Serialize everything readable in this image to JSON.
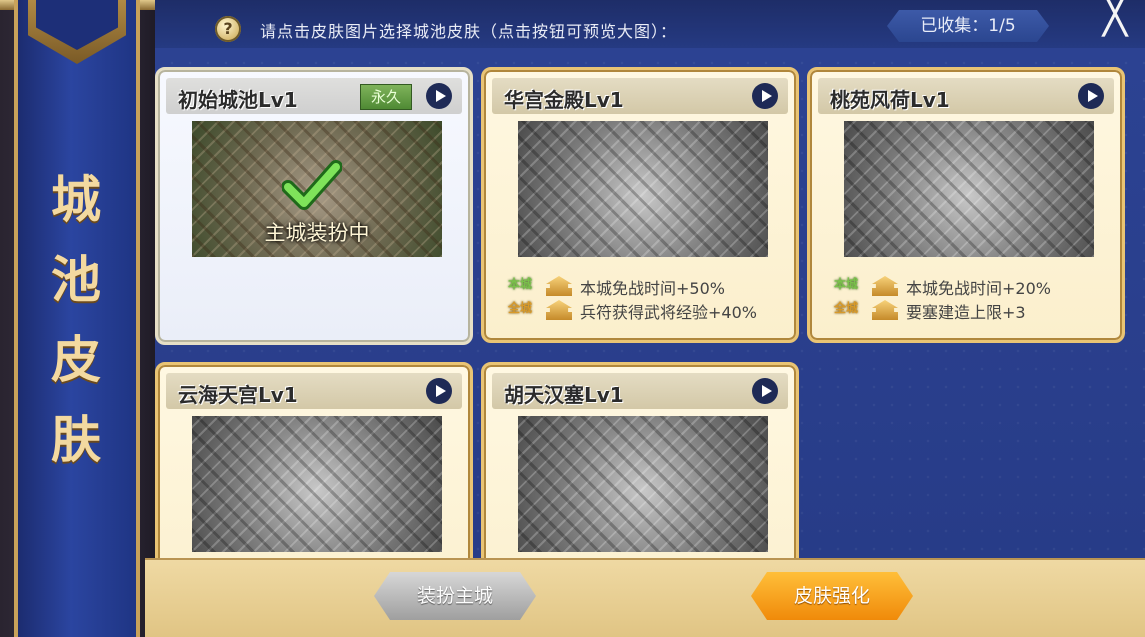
{
  "header": {
    "hint_icon_glyph": "?",
    "hint_text": "请点击皮肤图片选择城池皮肤（点击按钮可预览大图）：",
    "collected_label": "已收集：1/5",
    "close_glyph": "╳"
  },
  "banner": {
    "title_chars": [
      "城",
      "池",
      "皮",
      "肤"
    ]
  },
  "cards": [
    {
      "title": "初始城池Lv1",
      "badge": "永久",
      "selected": true,
      "thumbnail_state": "color",
      "status_label": "主城装扮中"
    },
    {
      "title": "华宫金殿Lv1",
      "selected": false,
      "thumbnail_state": "grayscale",
      "bonuses": [
        {
          "tag": "本城",
          "text": "本城免战时间+50%"
        },
        {
          "tag": "全城",
          "text": "兵符获得武将经验+40%"
        }
      ]
    },
    {
      "title": "桃苑风荷Lv1",
      "selected": false,
      "thumbnail_state": "grayscale",
      "bonuses": [
        {
          "tag": "本城",
          "text": "本城免战时间+20%"
        },
        {
          "tag": "全城",
          "text": "要塞建造上限+3"
        }
      ]
    },
    {
      "title": "云海天宫Lv1",
      "selected": false,
      "thumbnail_state": "grayscale"
    },
    {
      "title": "胡天汉塞Lv1",
      "selected": false,
      "thumbnail_state": "grayscale"
    }
  ],
  "buttons": {
    "equip": "装扮主城",
    "enhance": "皮肤强化"
  },
  "colors": {
    "panel_blue": "#2c4393",
    "banner_gold": "#c8a25a",
    "card_cream": "#fff8e2",
    "enhance_orange": "#f08a0a",
    "bonus_green": "#7ac14b",
    "bonus_gold": "#d89a2a"
  },
  "icons": {
    "hint": "question-icon",
    "close": "close-icon",
    "preview": "play-icon",
    "selected": "checkmark-icon",
    "rank": "rank-icon"
  }
}
